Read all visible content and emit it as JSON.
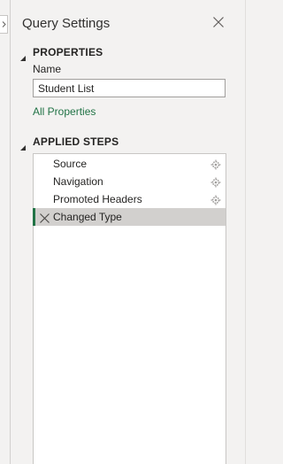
{
  "panel": {
    "title": "Query Settings"
  },
  "properties": {
    "header": "PROPERTIES",
    "name_label": "Name",
    "name_value": "Student List",
    "all_properties_link": "All Properties"
  },
  "applied_steps": {
    "header": "APPLIED STEPS",
    "steps": [
      {
        "label": "Source",
        "has_settings": true,
        "selected": false
      },
      {
        "label": "Navigation",
        "has_settings": true,
        "selected": false
      },
      {
        "label": "Promoted Headers",
        "has_settings": true,
        "selected": false
      },
      {
        "label": "Changed Type",
        "has_settings": false,
        "selected": true
      }
    ]
  },
  "colors": {
    "accent_green": "#217346",
    "selected_row": "#d2d0ce",
    "panel_bg": "#f3f2f1"
  },
  "icons": {
    "collapse": "chevron-right-icon",
    "close": "close-icon",
    "section_toggle": "triangle-down-icon",
    "step_settings": "gear-icon",
    "step_delete": "delete-step-icon"
  }
}
